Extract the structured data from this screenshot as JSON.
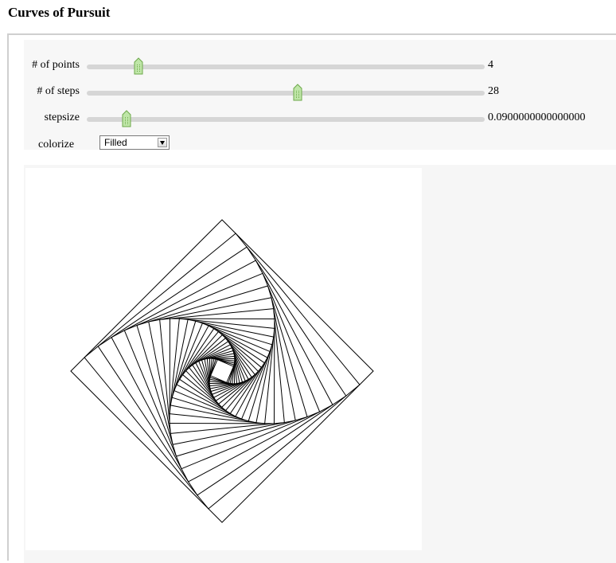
{
  "page": {
    "title": "Curves of Pursuit"
  },
  "controls": {
    "points": {
      "label": "# of points",
      "value": "4",
      "fraction": 0.12
    },
    "steps": {
      "label": "# of steps",
      "value": "28",
      "fraction": 0.53
    },
    "stepsize": {
      "label": "stepsize",
      "value": "0.0900000000000000",
      "fraction": 0.09
    },
    "colorize": {
      "label": "colorize",
      "selected": "Filled"
    }
  },
  "plot": {
    "n_points": 4,
    "n_steps": 28,
    "stepsize": 0.09,
    "mode": "Filled",
    "outline_color": "#000000"
  }
}
